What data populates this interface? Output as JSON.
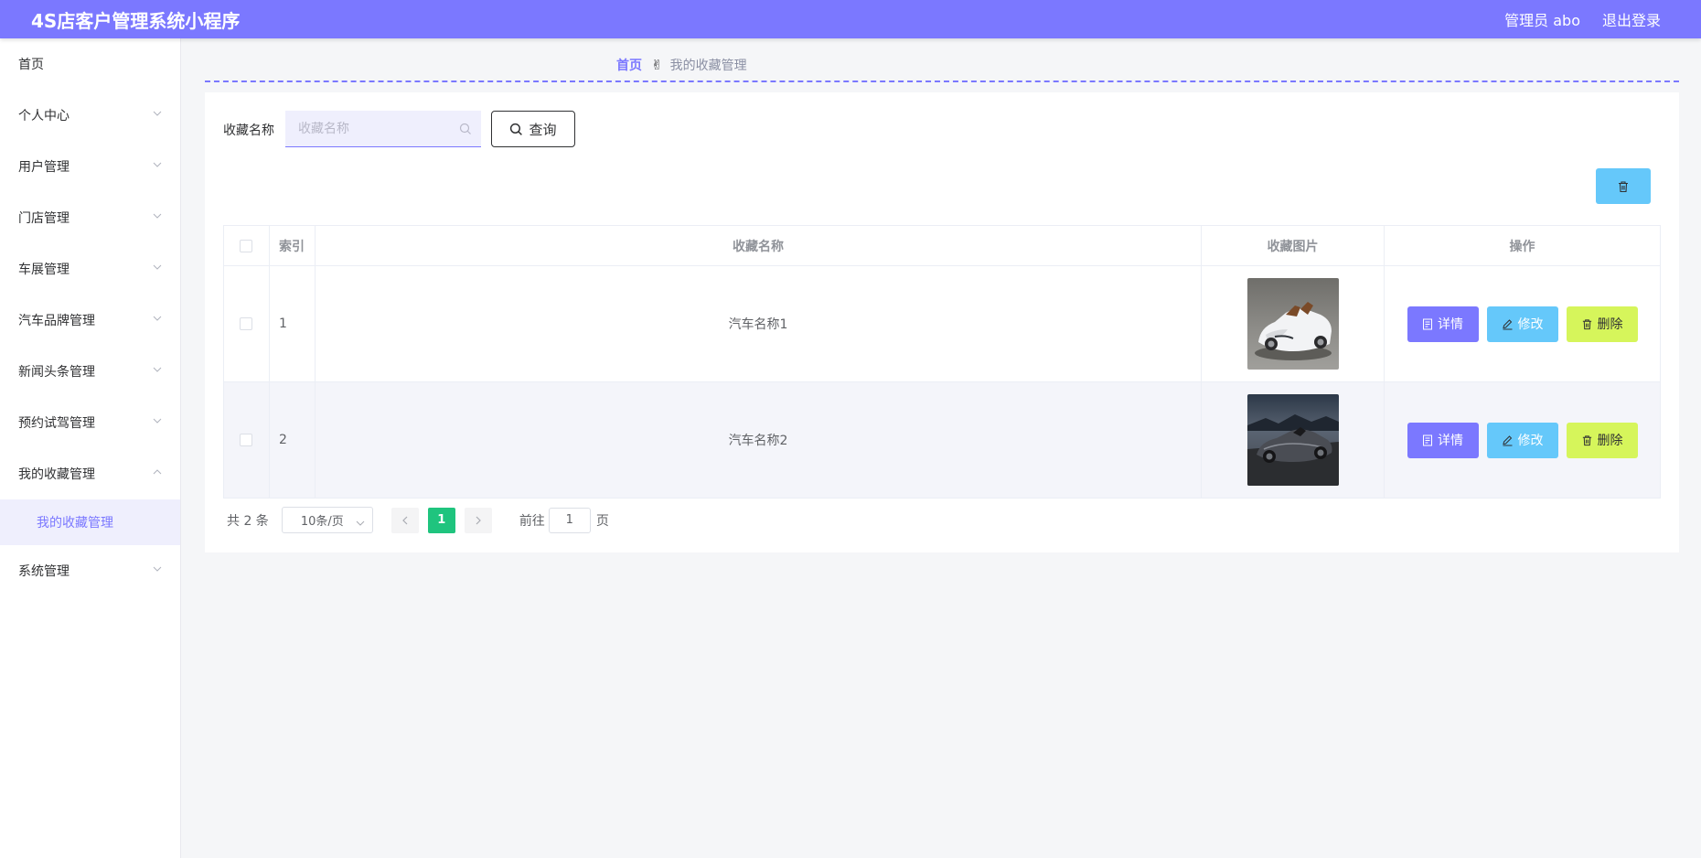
{
  "header": {
    "title": "4S店客户管理系统小程序",
    "user": "管理员 abo",
    "logout": "退出登录"
  },
  "sidebar": {
    "items": [
      {
        "label": "首页",
        "has_children": false
      },
      {
        "label": "个人中心",
        "has_children": true
      },
      {
        "label": "用户管理",
        "has_children": true
      },
      {
        "label": "门店管理",
        "has_children": true
      },
      {
        "label": "车展管理",
        "has_children": true
      },
      {
        "label": "汽车品牌管理",
        "has_children": true
      },
      {
        "label": "新闻头条管理",
        "has_children": true
      },
      {
        "label": "预约试驾管理",
        "has_children": true
      },
      {
        "label": "我的收藏管理",
        "has_children": true,
        "expanded": true
      },
      {
        "label": "系统管理",
        "has_children": true
      }
    ],
    "sub_item": "我的收藏管理"
  },
  "breadcrumb": {
    "home": "首页",
    "separator": "✌",
    "current": "我的收藏管理"
  },
  "search": {
    "label": "收藏名称",
    "placeholder": "收藏名称",
    "value": "",
    "query_button": "查询"
  },
  "table": {
    "columns": [
      "索引",
      "收藏名称",
      "收藏图片",
      "操作"
    ],
    "rows": [
      {
        "index": "1",
        "name": "汽车名称1",
        "image": "white-roadster"
      },
      {
        "index": "2",
        "name": "汽车名称2",
        "image": "dark-roadster"
      }
    ],
    "actions": {
      "detail": "详情",
      "edit": "修改",
      "delete": "删除"
    }
  },
  "pagination": {
    "total": "共 2 条",
    "page_size": "10条/页",
    "current_page": "1",
    "goto_prefix": "前往",
    "goto_value": "1",
    "goto_suffix": "页"
  },
  "colors": {
    "primary": "#7b78ff",
    "info": "#65c8fa",
    "warning": "#d6f55b",
    "success": "#1fc47e"
  }
}
